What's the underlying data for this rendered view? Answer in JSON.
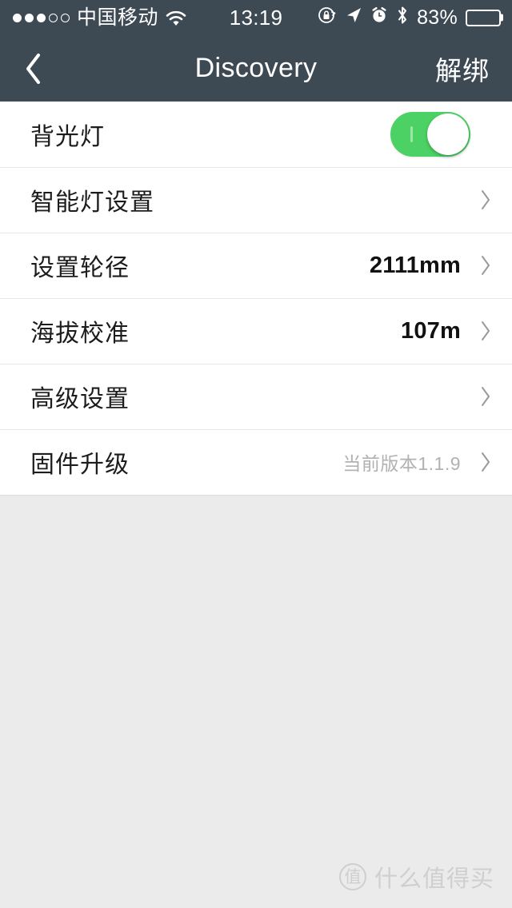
{
  "status_bar": {
    "signal_dots_filled": 3,
    "signal_dots_total": 5,
    "carrier": "中国移动",
    "wifi_icon": "wifi-icon",
    "time": "13:19",
    "icons": [
      "rotation-lock-icon",
      "location-arrow-icon",
      "alarm-clock-icon",
      "bluetooth-icon"
    ],
    "battery_percent": "83%",
    "battery_level": 83,
    "background_color": "#3d4a54"
  },
  "nav_bar": {
    "back_icon": "chevron-left-icon",
    "title": "Discovery",
    "action_label": "解绑"
  },
  "list": {
    "rows": [
      {
        "label": "背光灯",
        "type": "toggle",
        "toggle_on": true,
        "toggle_color": "#4cd264"
      },
      {
        "label": "智能灯设置",
        "type": "link",
        "value": ""
      },
      {
        "label": "设置轮径",
        "type": "value",
        "value": "2111mm"
      },
      {
        "label": "海拔校准",
        "type": "value",
        "value": "107m"
      },
      {
        "label": "高级设置",
        "type": "link",
        "value": ""
      },
      {
        "label": "固件升级",
        "type": "muted-value",
        "value": "当前版本1.1.9"
      }
    ]
  },
  "watermark": {
    "logo_text": "值",
    "text": "什么值得买"
  },
  "colors": {
    "bar": "#3d4a54",
    "page_background": "#ebebeb",
    "row_background": "#ffffff",
    "accent_green": "#4cd264"
  }
}
